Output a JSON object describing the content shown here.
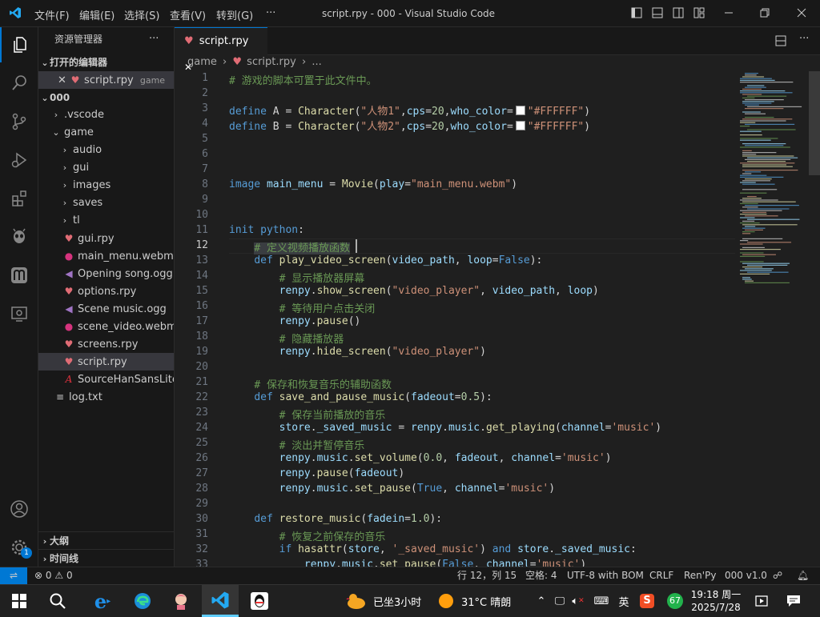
{
  "titlebar": {
    "menus": [
      "文件(F)",
      "编辑(E)",
      "选择(S)",
      "查看(V)",
      "转到(G)",
      "···"
    ],
    "title": "script.rpy - 000 - Visual Studio Code"
  },
  "sidebar": {
    "header": "资源管理器",
    "more": "···",
    "open_editors": {
      "label": "打开的编辑器",
      "files": [
        {
          "name": "script.rpy",
          "folder": "game"
        }
      ]
    },
    "workspace": "000",
    "tree": [
      {
        "name": ".vscode",
        "type": "folder",
        "depth": 1
      },
      {
        "name": "game",
        "type": "folder-open",
        "depth": 1
      },
      {
        "name": "audio",
        "type": "folder",
        "depth": 2
      },
      {
        "name": "gui",
        "type": "folder",
        "depth": 2
      },
      {
        "name": "images",
        "type": "folder",
        "depth": 2
      },
      {
        "name": "saves",
        "type": "folder",
        "depth": 2
      },
      {
        "name": "tl",
        "type": "folder",
        "depth": 2
      },
      {
        "name": "gui.rpy",
        "type": "rpy",
        "depth": 2
      },
      {
        "name": "main_menu.webm",
        "type": "video",
        "depth": 2
      },
      {
        "name": "Opening song.ogg",
        "type": "audio",
        "depth": 2
      },
      {
        "name": "options.rpy",
        "type": "rpy",
        "depth": 2
      },
      {
        "name": "Scene music.ogg",
        "type": "audio",
        "depth": 2
      },
      {
        "name": "scene_video.webm",
        "type": "video",
        "depth": 2
      },
      {
        "name": "screens.rpy",
        "type": "rpy",
        "depth": 2
      },
      {
        "name": "script.rpy",
        "type": "rpy",
        "depth": 2,
        "selected": true
      },
      {
        "name": "SourceHanSansLite.ttf",
        "type": "font",
        "depth": 2
      },
      {
        "name": "log.txt",
        "type": "text",
        "depth": 1
      }
    ],
    "outline": "大纲",
    "timeline": "时间线"
  },
  "editor": {
    "tab": {
      "name": "script.rpy",
      "close": "✕"
    },
    "breadcrumb": [
      "game",
      "script.rpy",
      "..."
    ],
    "current_line": 12,
    "lines": [
      [
        [
          "c",
          "# 游戏的脚本可置于此文件中。"
        ]
      ],
      [],
      [
        [
          "k",
          "define"
        ],
        [
          "o",
          " A = "
        ],
        [
          "f",
          "Character"
        ],
        [
          "o",
          "("
        ],
        [
          "s",
          "\"人物1\""
        ],
        [
          "o",
          ","
        ],
        [
          "v",
          "cps"
        ],
        [
          "o",
          "="
        ],
        [
          "n",
          "20"
        ],
        [
          "o",
          ","
        ],
        [
          "v",
          "who_color"
        ],
        [
          "o",
          "="
        ],
        [
          "sw",
          ""
        ],
        [
          "s",
          "\"#FFFFFF\""
        ],
        [
          "o",
          ")"
        ]
      ],
      [
        [
          "k",
          "define"
        ],
        [
          "o",
          " B = "
        ],
        [
          "f",
          "Character"
        ],
        [
          "o",
          "("
        ],
        [
          "s",
          "\"人物2\""
        ],
        [
          "o",
          ","
        ],
        [
          "v",
          "cps"
        ],
        [
          "o",
          "="
        ],
        [
          "n",
          "20"
        ],
        [
          "o",
          ","
        ],
        [
          "v",
          "who_color"
        ],
        [
          "o",
          "="
        ],
        [
          "sw",
          ""
        ],
        [
          "s",
          "\"#FFFFFF\""
        ],
        [
          "o",
          ")"
        ]
      ],
      [],
      [],
      [],
      [
        [
          "k",
          "image"
        ],
        [
          "v",
          " main_menu"
        ],
        [
          "o",
          " = "
        ],
        [
          "f",
          "Movie"
        ],
        [
          "o",
          "("
        ],
        [
          "v",
          "play"
        ],
        [
          "o",
          "="
        ],
        [
          "s",
          "\"main_menu.webm\""
        ],
        [
          "o",
          ")"
        ]
      ],
      [],
      [],
      [
        [
          "k",
          "init"
        ],
        [
          "o",
          " "
        ],
        [
          "k",
          "python"
        ],
        [
          "o",
          ":"
        ]
      ],
      [
        [
          "o",
          "    "
        ],
        [
          "c",
          "# 定义视频播放函数"
        ]
      ],
      [
        [
          "o",
          "    "
        ],
        [
          "k",
          "def"
        ],
        [
          "o",
          " "
        ],
        [
          "f",
          "play_video_screen"
        ],
        [
          "o",
          "("
        ],
        [
          "v",
          "video_path"
        ],
        [
          "o",
          ", "
        ],
        [
          "v",
          "loop"
        ],
        [
          "o",
          "="
        ],
        [
          "k",
          "False"
        ],
        [
          "o",
          "):"
        ]
      ],
      [
        [
          "o",
          "        "
        ],
        [
          "c",
          "# 显示播放器屏幕"
        ]
      ],
      [
        [
          "o",
          "        "
        ],
        [
          "v",
          "renpy"
        ],
        [
          "o",
          "."
        ],
        [
          "f",
          "show_screen"
        ],
        [
          "o",
          "("
        ],
        [
          "s",
          "\"video_player\""
        ],
        [
          "o",
          ", "
        ],
        [
          "v",
          "video_path"
        ],
        [
          "o",
          ", "
        ],
        [
          "v",
          "loop"
        ],
        [
          "o",
          ")"
        ]
      ],
      [
        [
          "o",
          "        "
        ],
        [
          "c",
          "# 等待用户点击关闭"
        ]
      ],
      [
        [
          "o",
          "        "
        ],
        [
          "v",
          "renpy"
        ],
        [
          "o",
          "."
        ],
        [
          "f",
          "pause"
        ],
        [
          "o",
          "()"
        ]
      ],
      [
        [
          "o",
          "        "
        ],
        [
          "c",
          "# 隐藏播放器"
        ]
      ],
      [
        [
          "o",
          "        "
        ],
        [
          "v",
          "renpy"
        ],
        [
          "o",
          "."
        ],
        [
          "f",
          "hide_screen"
        ],
        [
          "o",
          "("
        ],
        [
          "s",
          "\"video_player\""
        ],
        [
          "o",
          ")"
        ]
      ],
      [],
      [
        [
          "o",
          "    "
        ],
        [
          "c",
          "# 保存和恢复音乐的辅助函数"
        ]
      ],
      [
        [
          "o",
          "    "
        ],
        [
          "k",
          "def"
        ],
        [
          "o",
          " "
        ],
        [
          "f",
          "save_and_pause_music"
        ],
        [
          "o",
          "("
        ],
        [
          "v",
          "fadeout"
        ],
        [
          "o",
          "="
        ],
        [
          "n",
          "0.5"
        ],
        [
          "o",
          "):"
        ]
      ],
      [
        [
          "o",
          "        "
        ],
        [
          "c",
          "# 保存当前播放的音乐"
        ]
      ],
      [
        [
          "o",
          "        "
        ],
        [
          "v",
          "store"
        ],
        [
          "o",
          "."
        ],
        [
          "v",
          "_saved_music"
        ],
        [
          "o",
          " = "
        ],
        [
          "v",
          "renpy"
        ],
        [
          "o",
          "."
        ],
        [
          "v",
          "music"
        ],
        [
          "o",
          "."
        ],
        [
          "f",
          "get_playing"
        ],
        [
          "o",
          "("
        ],
        [
          "v",
          "channel"
        ],
        [
          "o",
          "="
        ],
        [
          "s",
          "'music'"
        ],
        [
          "o",
          ")"
        ]
      ],
      [
        [
          "o",
          "        "
        ],
        [
          "c",
          "# 淡出并暂停音乐"
        ]
      ],
      [
        [
          "o",
          "        "
        ],
        [
          "v",
          "renpy"
        ],
        [
          "o",
          "."
        ],
        [
          "v",
          "music"
        ],
        [
          "o",
          "."
        ],
        [
          "f",
          "set_volume"
        ],
        [
          "o",
          "("
        ],
        [
          "n",
          "0.0"
        ],
        [
          "o",
          ", "
        ],
        [
          "v",
          "fadeout"
        ],
        [
          "o",
          ", "
        ],
        [
          "v",
          "channel"
        ],
        [
          "o",
          "="
        ],
        [
          "s",
          "'music'"
        ],
        [
          "o",
          ")"
        ]
      ],
      [
        [
          "o",
          "        "
        ],
        [
          "v",
          "renpy"
        ],
        [
          "o",
          "."
        ],
        [
          "f",
          "pause"
        ],
        [
          "o",
          "("
        ],
        [
          "v",
          "fadeout"
        ],
        [
          "o",
          ")"
        ]
      ],
      [
        [
          "o",
          "        "
        ],
        [
          "v",
          "renpy"
        ],
        [
          "o",
          "."
        ],
        [
          "v",
          "music"
        ],
        [
          "o",
          "."
        ],
        [
          "f",
          "set_pause"
        ],
        [
          "o",
          "("
        ],
        [
          "k",
          "True"
        ],
        [
          "o",
          ", "
        ],
        [
          "v",
          "channel"
        ],
        [
          "o",
          "="
        ],
        [
          "s",
          "'music'"
        ],
        [
          "o",
          ")"
        ]
      ],
      [],
      [
        [
          "o",
          "    "
        ],
        [
          "k",
          "def"
        ],
        [
          "o",
          " "
        ],
        [
          "f",
          "restore_music"
        ],
        [
          "o",
          "("
        ],
        [
          "v",
          "fadein"
        ],
        [
          "o",
          "="
        ],
        [
          "n",
          "1.0"
        ],
        [
          "o",
          "):"
        ]
      ],
      [
        [
          "o",
          "        "
        ],
        [
          "c",
          "# 恢复之前保存的音乐"
        ]
      ],
      [
        [
          "o",
          "        "
        ],
        [
          "k",
          "if"
        ],
        [
          "o",
          " "
        ],
        [
          "f",
          "hasattr"
        ],
        [
          "o",
          "("
        ],
        [
          "v",
          "store"
        ],
        [
          "o",
          ", "
        ],
        [
          "s",
          "'_saved_music'"
        ],
        [
          "o",
          ") "
        ],
        [
          "k",
          "and"
        ],
        [
          "o",
          " "
        ],
        [
          "v",
          "store"
        ],
        [
          "o",
          "."
        ],
        [
          "v",
          "_saved_music"
        ],
        [
          "o",
          ":"
        ]
      ],
      [
        [
          "o",
          "            "
        ],
        [
          "v",
          "renpy"
        ],
        [
          "o",
          "."
        ],
        [
          "v",
          "music"
        ],
        [
          "o",
          "."
        ],
        [
          "f",
          "set_pause"
        ],
        [
          "o",
          "("
        ],
        [
          "k",
          "False"
        ],
        [
          "o",
          ", "
        ],
        [
          "v",
          "channel"
        ],
        [
          "o",
          "="
        ],
        [
          "s",
          "'music'"
        ],
        [
          "o",
          ")"
        ]
      ]
    ]
  },
  "status": {
    "errors": "0",
    "warnings": "0",
    "position": "行 12，列 15",
    "spaces": "空格: 4",
    "encoding": "UTF-8 with BOM",
    "eol": "CRLF",
    "language": "Ren'Py",
    "version": "000 v1.0"
  },
  "taskbar": {
    "sitting": "已坐3小时",
    "weather": "31°C  晴朗",
    "ime": "英",
    "badge": "67",
    "time": "19:18 周一",
    "date": "2025/7/28"
  },
  "accounts_badge": "1",
  "colors": {
    "accent": "#0078d4",
    "background": "#1f1f1f",
    "sidebar": "#181818"
  }
}
